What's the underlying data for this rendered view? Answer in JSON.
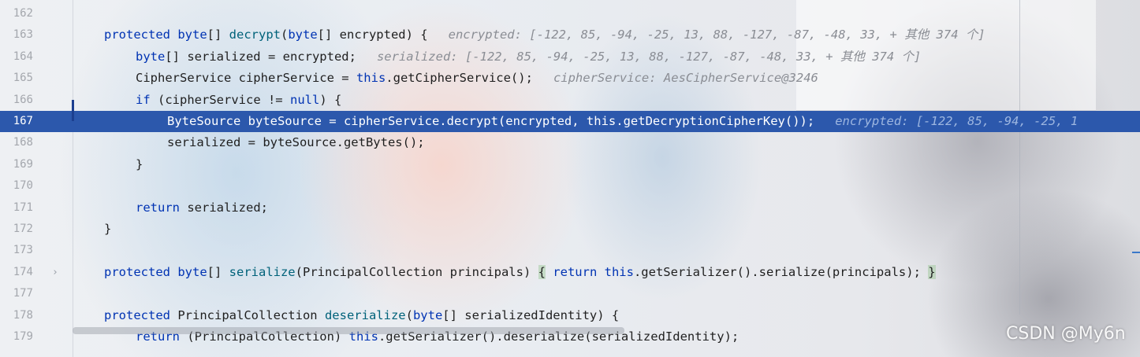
{
  "editor": {
    "lines": [
      {
        "num": "162"
      },
      {
        "num": "163",
        "indent": 0,
        "tokens": [
          {
            "t": "protected ",
            "c": "kw"
          },
          {
            "t": "byte",
            "c": "kw"
          },
          {
            "t": "[] "
          },
          {
            "t": "decrypt",
            "c": "fn"
          },
          {
            "t": "("
          },
          {
            "t": "byte",
            "c": "kw"
          },
          {
            "t": "[] encrypted) {"
          }
        ],
        "hint": "encrypted: [-122, 85, -94, -25, 13, 88, -127, -87, -48, 33, + 其他 374 个]"
      },
      {
        "num": "164",
        "indent": 1,
        "tokens": [
          {
            "t": "byte",
            "c": "kw"
          },
          {
            "t": "[] serialized = encrypted;"
          }
        ],
        "hint": "serialized: [-122, 85, -94, -25, 13, 88, -127, -87, -48, 33, + 其他 374 个]"
      },
      {
        "num": "165",
        "indent": 1,
        "tokens": [
          {
            "t": "CipherService cipherService = "
          },
          {
            "t": "this",
            "c": "kw"
          },
          {
            "t": ".getCipherService();"
          }
        ],
        "hint": "cipherService: AesCipherService@3246"
      },
      {
        "num": "166",
        "indent": 1,
        "tokens": [
          {
            "t": "if",
            "c": "kw"
          },
          {
            "t": " (cipherService != "
          },
          {
            "t": "null",
            "c": "kw"
          },
          {
            "t": ") {"
          }
        ]
      },
      {
        "num": "167",
        "indent": 2,
        "exec": true,
        "tokens": [
          {
            "t": "ByteSource byteSource = cipherService.decrypt(encrypted, this.getDecryptionCipherKey());"
          }
        ],
        "hint": "encrypted: [-122, 85, -94, -25, 1"
      },
      {
        "num": "168",
        "indent": 2,
        "tokens": [
          {
            "t": "serialized = byteSource.getBytes();"
          }
        ]
      },
      {
        "num": "169",
        "indent": 1,
        "tokens": [
          {
            "t": "}"
          }
        ]
      },
      {
        "num": "170"
      },
      {
        "num": "171",
        "indent": 1,
        "tokens": [
          {
            "t": "return",
            "c": "kw"
          },
          {
            "t": " serialized;"
          }
        ]
      },
      {
        "num": "172",
        "indent": 0,
        "tokens": [
          {
            "t": "}"
          }
        ]
      },
      {
        "num": "173"
      },
      {
        "num": "174",
        "fold": true,
        "indent": 0,
        "tokens": [
          {
            "t": "protected ",
            "c": "kw"
          },
          {
            "t": "byte",
            "c": "kw"
          },
          {
            "t": "[] "
          },
          {
            "t": "serialize",
            "c": "fn"
          },
          {
            "t": "(PrincipalCollection principals) "
          },
          {
            "t": "{",
            "c": "brace"
          },
          {
            "t": " "
          },
          {
            "t": "return",
            "c": "kw"
          },
          {
            "t": " "
          },
          {
            "t": "this",
            "c": "kw"
          },
          {
            "t": ".getSerializer().serialize(principals); "
          },
          {
            "t": "}",
            "c": "brace"
          }
        ]
      },
      {
        "num": "177"
      },
      {
        "num": "178",
        "indent": 0,
        "tokens": [
          {
            "t": "protected ",
            "c": "kw"
          },
          {
            "t": "PrincipalCollection "
          },
          {
            "t": "deserialize",
            "c": "fn"
          },
          {
            "t": "("
          },
          {
            "t": "byte",
            "c": "kw"
          },
          {
            "t": "[] serializedIdentity) {"
          }
        ]
      },
      {
        "num": "179",
        "indent": 1,
        "tokens": [
          {
            "t": "return",
            "c": "kw"
          },
          {
            "t": " (PrincipalCollection) "
          },
          {
            "t": "this",
            "c": "kw"
          },
          {
            "t": ".getSerializer().deserialize(serializedIdentity);"
          }
        ]
      }
    ]
  },
  "watermark": "CSDN @My6n"
}
